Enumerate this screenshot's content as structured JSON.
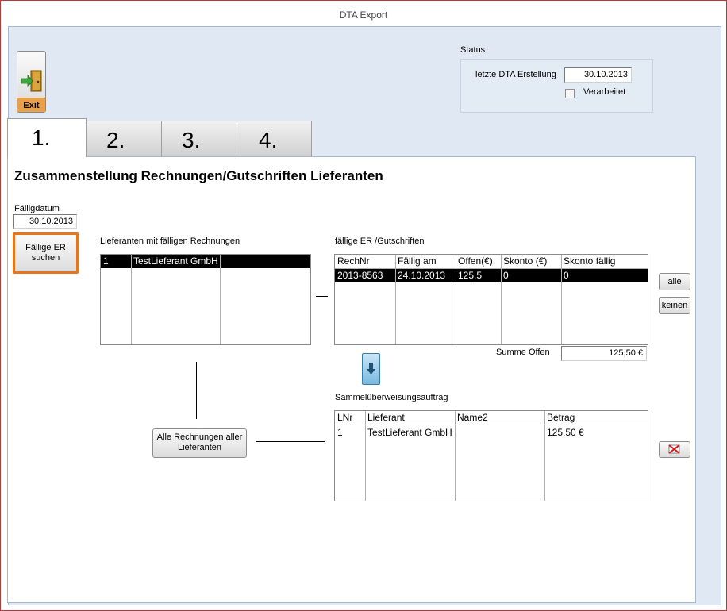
{
  "window": {
    "title": "DTA Export"
  },
  "exit_button": {
    "label": "Exit"
  },
  "status": {
    "title": "Status",
    "last_dta_label": "letzte DTA Erstellung",
    "last_dta_value": "30.10.2013",
    "processed_label": "Verarbeitet",
    "processed_checked": false
  },
  "tabs": [
    {
      "label": "1."
    },
    {
      "label": "2."
    },
    {
      "label": "3."
    },
    {
      "label": "4."
    }
  ],
  "panel": {
    "heading": "Zusammenstellung Rechnungen/Gutschriften Lieferanten"
  },
  "due_date": {
    "label": "Fälligdatum",
    "value": "30.10.2013"
  },
  "search_button": {
    "label_line1": "Fällige ER",
    "label_line2": "suchen"
  },
  "suppliers": {
    "title": "Lieferanten mit fälligen Rechnungen",
    "rows": [
      {
        "nr": "1",
        "name": "TestLieferant GmbH"
      }
    ]
  },
  "invoices": {
    "title": "fällige ER /Gutschriften",
    "columns": [
      "RechNr",
      "Fällig am",
      "Offen(€)",
      "Skonto (€)",
      "Skonto fällig"
    ],
    "rows": [
      [
        "2013-8563",
        "24.10.2013",
        "125,5",
        "0",
        "0"
      ]
    ]
  },
  "buttons": {
    "all": "alle",
    "none": "keinen",
    "all_invoices_line1": "Alle Rechnungen aller",
    "all_invoices_line2": "Lieferanten"
  },
  "sum_open": {
    "label": "Summe Offen",
    "value": "125,50 €"
  },
  "collective": {
    "title": "Sammelüberweisungsauftrag",
    "columns": [
      "LNr",
      "Lieferant",
      "Name2",
      "Betrag"
    ],
    "rows": [
      [
        "1",
        "TestLieferant GmbH",
        "",
        "125,50 €"
      ]
    ]
  },
  "colors": {
    "accent_orange": "#e8741c",
    "selection": "#000000",
    "client_bg": "#dfe8f3"
  },
  "icons": {
    "exit": "door-exit-icon",
    "move_down": "arrow-down-icon",
    "delete": "delete-x-icon"
  }
}
